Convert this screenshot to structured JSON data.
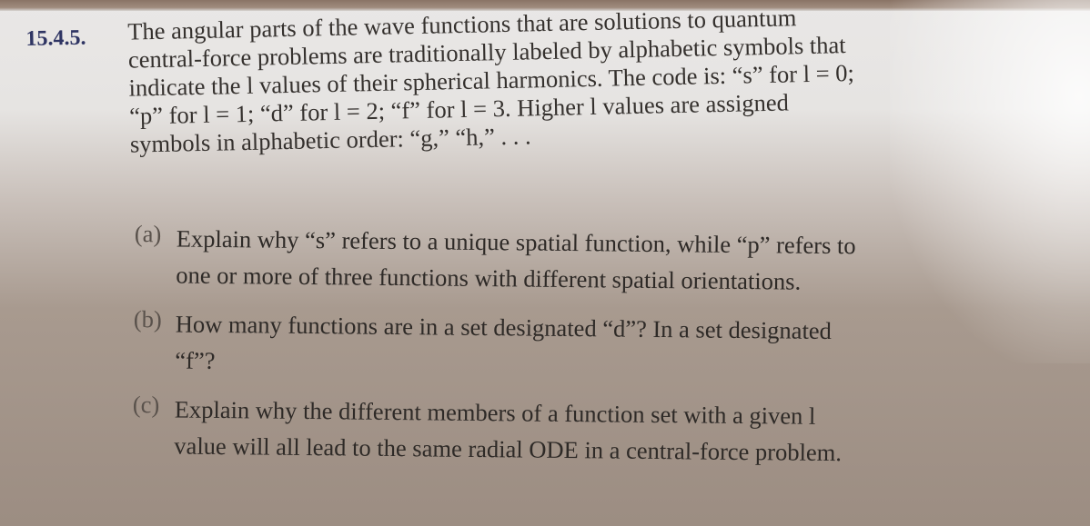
{
  "problem": {
    "number": "15.4.5.",
    "lines": [
      "The angular parts of the wave functions that are solutions to quantum",
      "central-force problems are traditionally labeled by alphabetic symbols that",
      "indicate the l values of their spherical harmonics. The code is: “s” for l = 0;",
      "“p” for l = 1;   “d” for l = 2;   “f” for l = 3. Higher l values are assigned",
      "symbols in alphabetic order: “g,” “h,” . . ."
    ]
  },
  "parts": [
    {
      "label": "(a)",
      "lines": [
        "Explain why “s” refers to a unique spatial function, while “p” refers to",
        "one or more of three functions with different spatial orientations."
      ]
    },
    {
      "label": "(b)",
      "lines": [
        "How many functions are in a set designated “d”? In a set designated",
        "“f”?"
      ]
    },
    {
      "label": "(c)",
      "lines": [
        "Explain why the different members of a function set with a given l",
        "value will all lead to the same radial ODE in a central-force problem."
      ]
    }
  ],
  "colors": {
    "problem_number": "#2f3563",
    "text": "#35312e",
    "paper_top": "#e9e7e6",
    "paper_bottom": "#9c8d82"
  }
}
